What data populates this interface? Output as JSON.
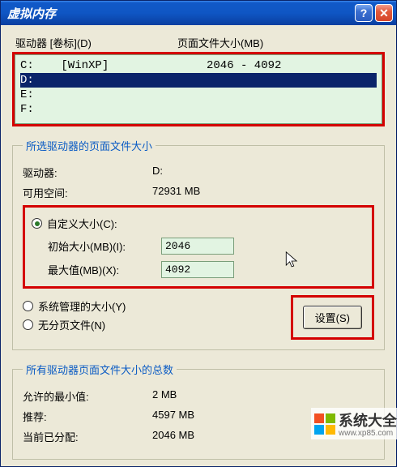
{
  "window": {
    "title": "虚拟内存"
  },
  "list_header": {
    "col_drive": "驱动器 [卷标](D)",
    "col_pagefile": "页面文件大小(MB)"
  },
  "drives": [
    {
      "label": "C:    [WinXP]",
      "pagefile": "2046 - 4092",
      "selected": false
    },
    {
      "label": "D:",
      "pagefile": "",
      "selected": true
    },
    {
      "label": "E:",
      "pagefile": "",
      "selected": false
    },
    {
      "label": "F:",
      "pagefile": "",
      "selected": false
    }
  ],
  "group_selected": {
    "legend": "所选驱动器的页面文件大小",
    "drive_label": "驱动器:",
    "drive_value": "D:",
    "space_label": "可用空间:",
    "space_value": "72931 MB",
    "radio_custom": "自定义大小(C):",
    "initial_label": "初始大小(MB)(I):",
    "initial_value": "2046",
    "max_label": "最大值(MB)(X):",
    "max_value": "4092",
    "radio_system": "系统管理的大小(Y)",
    "radio_none": "无分页文件(N)",
    "set_button": "设置(S)"
  },
  "group_total": {
    "legend": "所有驱动器页面文件大小的总数",
    "min_label": "允许的最小值:",
    "min_value": "2 MB",
    "rec_label": "推荐:",
    "rec_value": "4597 MB",
    "cur_label": "当前已分配:",
    "cur_value": "2046 MB"
  },
  "watermark": {
    "text": "系统大全",
    "sub": "www.xp85.com"
  }
}
